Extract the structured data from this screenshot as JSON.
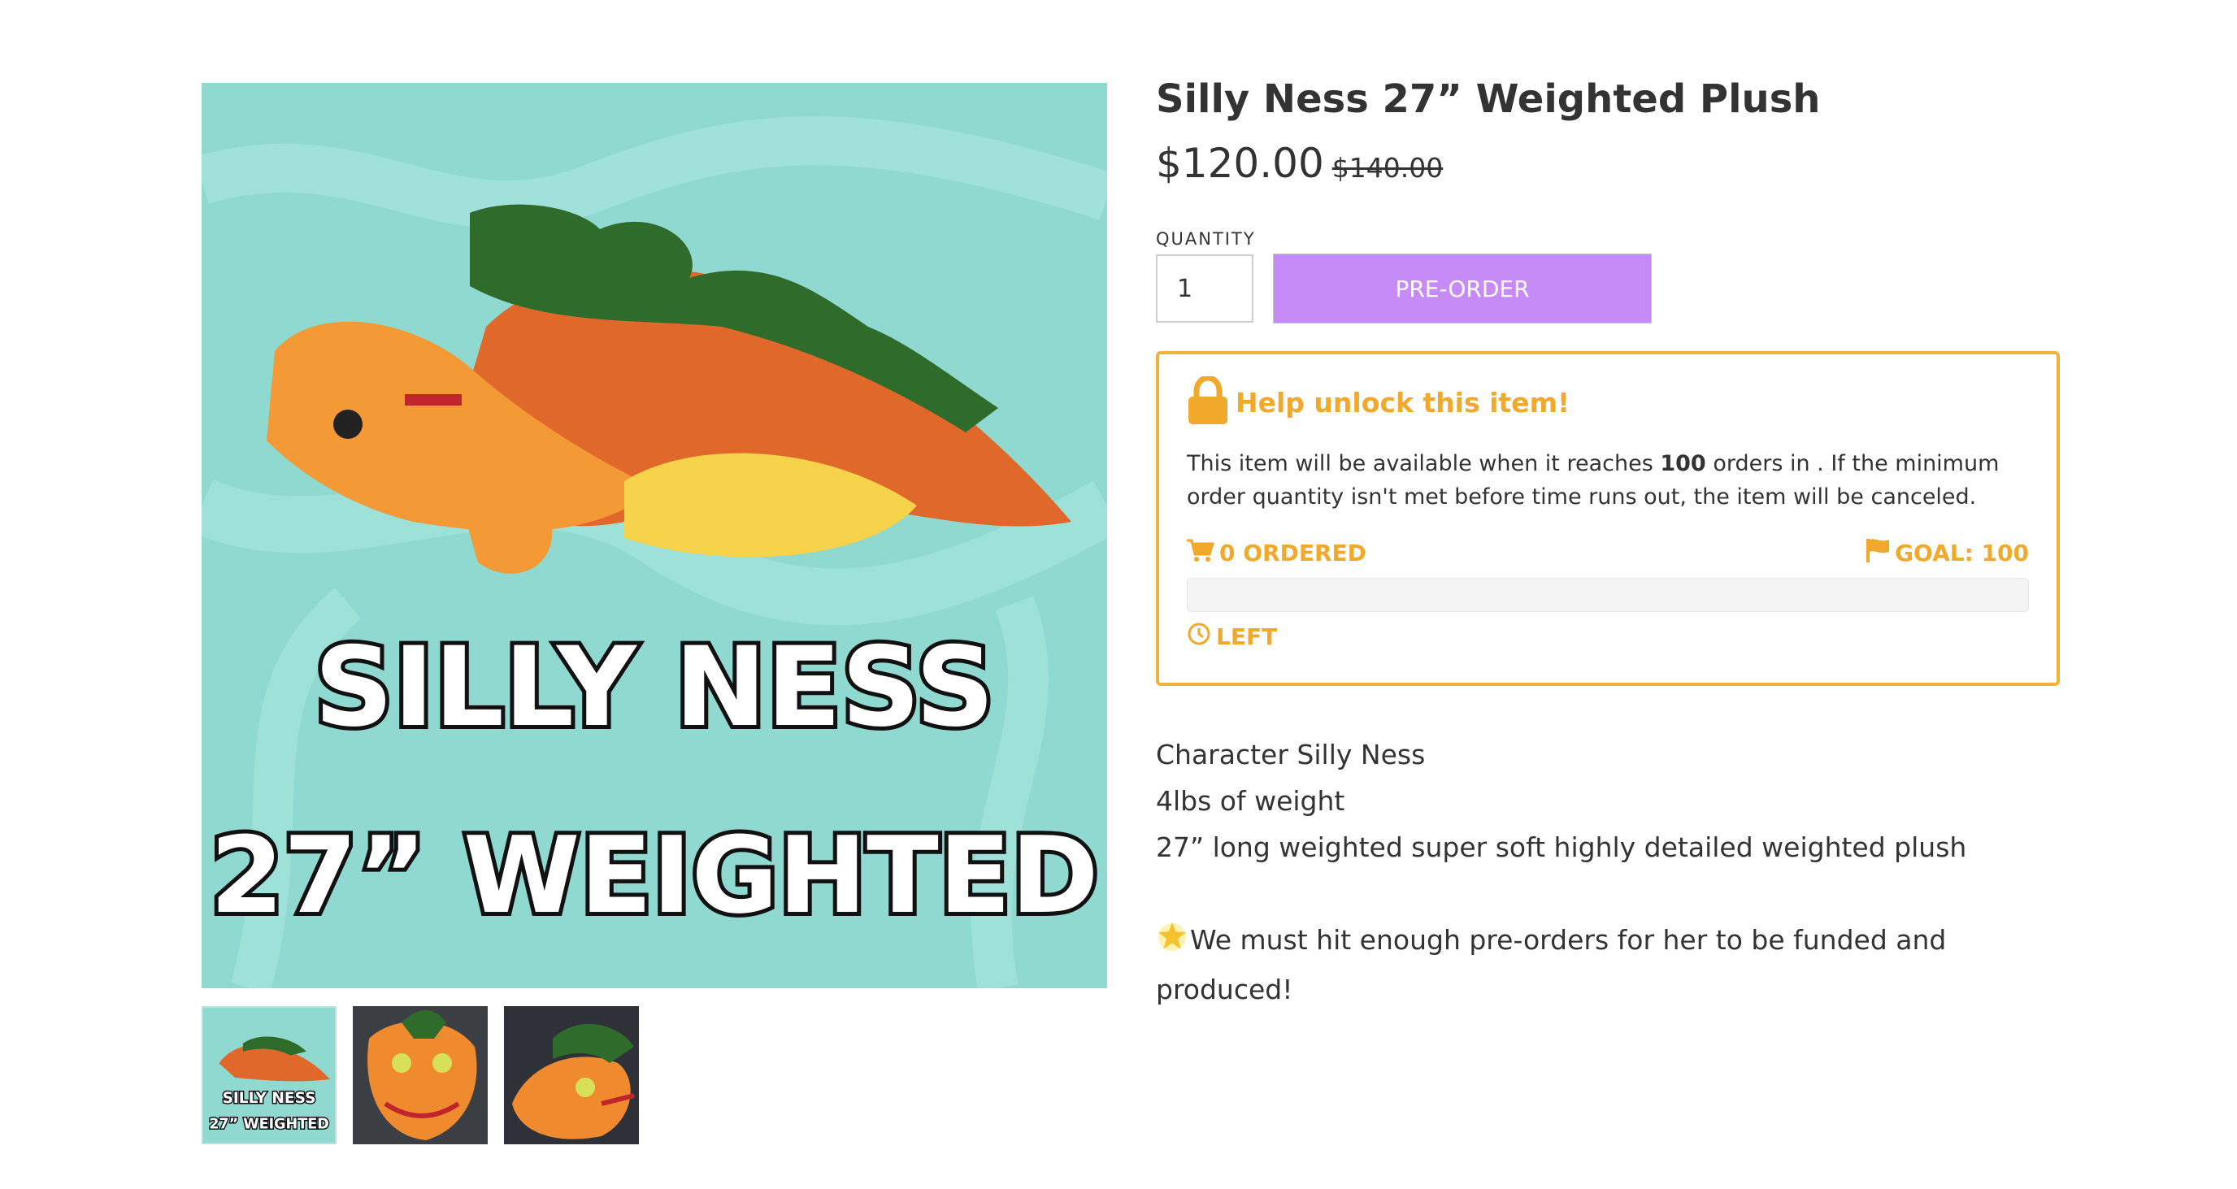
{
  "product": {
    "title": "Silly Ness 27” Weighted Plush",
    "price": "$120.00",
    "compare_price": "$140.00"
  },
  "gallery": {
    "main_image_text_line1": "SILLY NESS",
    "main_image_text_line2": "27” WEIGHTED",
    "thumb1_text_line1": "SILLY NESS",
    "thumb1_text_line2": "27” WEIGHTED",
    "background_color": "#8fd9d0"
  },
  "purchase": {
    "quantity_label": "QUANTITY",
    "quantity_value": "1",
    "preorder_label": "PRE-ORDER",
    "button_color": "#c78bf8"
  },
  "unlock": {
    "title": "Help unlock this item!",
    "text_before": "This item will be available when it reaches ",
    "goal_number": "100",
    "text_after": " orders in . If the minimum order quantity isn't met before time runs out, the item will be canceled.",
    "ordered_label": "0 ORDERED",
    "goal_label": "GOAL: 100",
    "time_left_label": "LEFT",
    "progress_fraction": 0,
    "accent_color": "#f0a92a",
    "icons": [
      "lock-icon",
      "cart-icon",
      "flag-icon",
      "clock-icon"
    ]
  },
  "description": {
    "line1": "Character Silly Ness",
    "line2": "4lbs of weight",
    "line3": "27” long weighted super soft highly detailed weighted plush",
    "line4": "We must hit enough pre-orders for her to be funded and produced!",
    "line4_icon": "glowing-star-icon"
  }
}
